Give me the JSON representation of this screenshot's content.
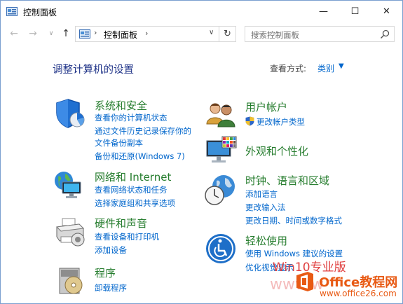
{
  "window": {
    "title": "控制面板",
    "minimize_glyph": "—",
    "maximize_glyph": "☐",
    "close_glyph": "✕"
  },
  "nav": {
    "back_glyph": "←",
    "forward_glyph": "→",
    "recent_glyph": "∨",
    "up_glyph": "↑"
  },
  "address": {
    "separator": "›",
    "path": "控制面板",
    "dropdown_glyph": "∨",
    "refresh_glyph": "↻"
  },
  "search": {
    "placeholder": "搜索控制面板"
  },
  "header": {
    "title": "调整计算机的设置",
    "view_label": "查看方式:",
    "view_value": "类别",
    "view_caret": "▼"
  },
  "categories": [
    {
      "icon": "security-shield-icon",
      "title": "系统和安全",
      "links": [
        "查看你的计算机状态",
        "通过文件历史记录保存你的",
        "文件备份副本",
        "备份和还原(Windows 7)"
      ]
    },
    {
      "icon": "network-globe-icon",
      "title": "网络和 Internet",
      "links": [
        "查看网络状态和任务",
        "选择家庭组和共享选项"
      ]
    },
    {
      "icon": "printer-icon",
      "title": "硬件和声音",
      "links": [
        "查看设备和打印机",
        "添加设备"
      ]
    },
    {
      "icon": "programs-disc-icon",
      "title": "程序",
      "links": [
        "卸载程序"
      ]
    },
    {
      "icon": "users-icon",
      "title": "用户帐户",
      "links": [
        "更改帐户类型"
      ]
    },
    {
      "icon": "appearance-monitor-icon",
      "title": "外观和个性化",
      "links": []
    },
    {
      "icon": "clock-globe-icon",
      "title": "时钟、语言和区域",
      "links": [
        "添加语言",
        "更改输入法",
        "更改日期、时间或数字格式"
      ]
    },
    {
      "icon": "ease-of-access-icon",
      "title": "轻松使用",
      "links": [
        "使用 Windows 建议的设置",
        "优化视觉显示"
      ]
    }
  ],
  "watermark": {
    "line1": "Win10专业版",
    "line2": "www.w",
    "brand": "Office教程网",
    "url": "www.office26.com"
  },
  "colors": {
    "category_title": "#267d2e",
    "link": "#0066cc",
    "page_title": "#1e3287",
    "watermark": "#e04040"
  }
}
